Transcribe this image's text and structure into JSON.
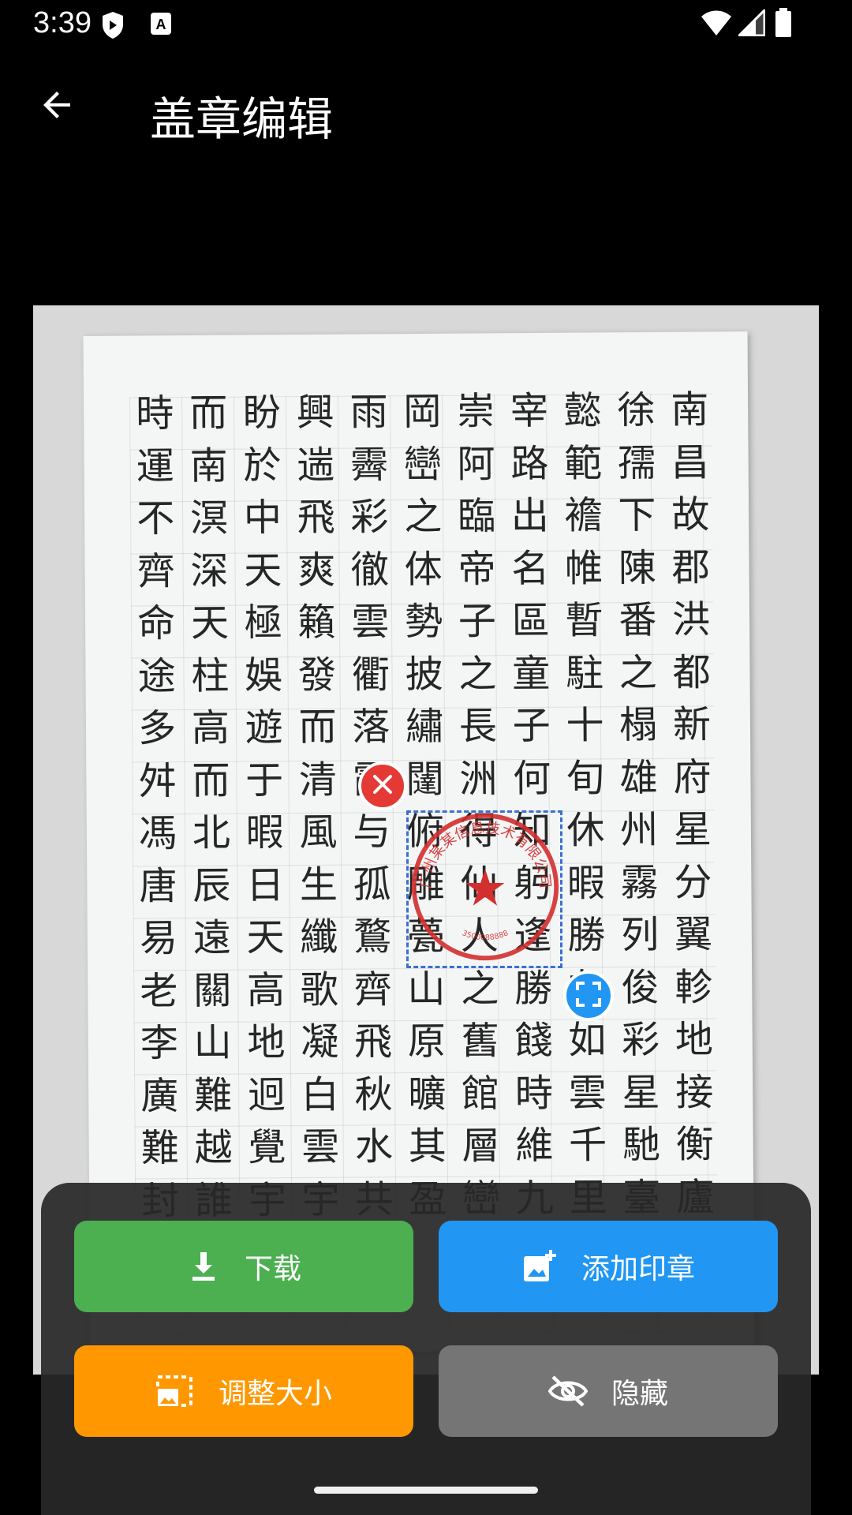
{
  "status_bar": {
    "time": "3:39"
  },
  "app_bar": {
    "title": "盖章编辑"
  },
  "document": {
    "columns": [
      "南昌故郡洪都新府星分翼軫地接衡廬",
      "徐孺下陳番之榻雄州霧列俊彩星馳臺",
      "懿範襜帷暫駐十旬休暇勝友如雲千里",
      "宰路出名區童子何知躬逢勝餞時維九",
      "崇阿臨帝子之長洲得仙人之舊館層巒",
      "岡巒之体勢披繡闥俯雕甍山原曠其盈",
      "雨霽彩徹雲衢落霞与孤鶩齊飛秋水共",
      "興遄飛爽籟發而清風生纖歌凝白雲宇",
      "盼於中天極娛遊于暇日天高地迥覺宇",
      "而南溟深天柱高而北辰遠關山難越誰",
      "時運不齊命途多舛馮唐易老李廣難封"
    ]
  },
  "stamp": {
    "ring_text": "广州某某信息技术有限公司",
    "number_text": "3500088888",
    "center_symbol": "★",
    "color": "#d32f2f"
  },
  "actions": {
    "download_label": "下载",
    "add_stamp_label": "添加印章",
    "resize_label": "调整大小",
    "hide_label": "隐藏"
  },
  "colors": {
    "download": "#4caf50",
    "add_stamp": "#2196f3",
    "resize": "#ff9800",
    "hide": "#757575",
    "selection": "#3b6fd6"
  },
  "icons": {
    "back": "arrow-back-icon",
    "download": "download-icon",
    "add_stamp": "add-photo-icon",
    "resize": "photo-size-select-icon",
    "hide": "visibility-off-icon",
    "close": "close-icon",
    "resize_handle": "fullscreen-icon"
  }
}
